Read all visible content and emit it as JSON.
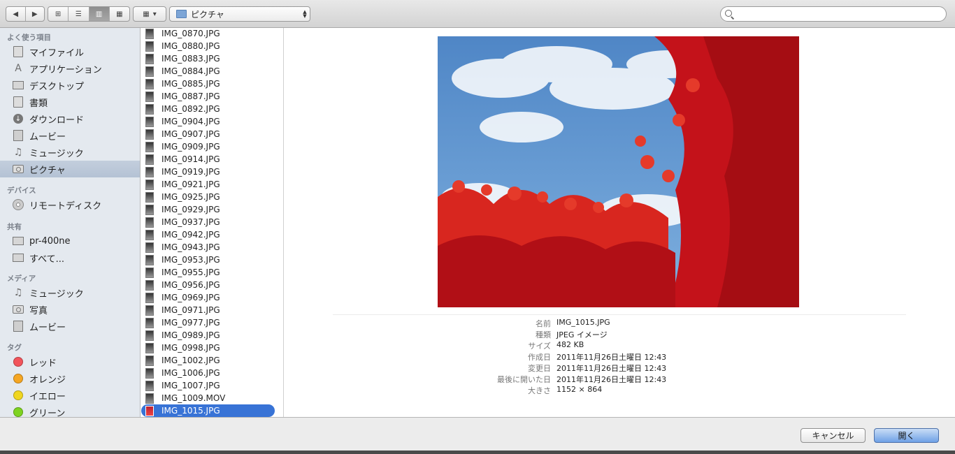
{
  "toolbar": {
    "back_icon": "◀",
    "forward_icon": "▶",
    "view_icons": [
      "⊞",
      "☰",
      "▥",
      "▦"
    ],
    "arrange_icon": "▦",
    "arrange_caret": "▾",
    "location": "ピクチャ",
    "location_arrows_up": "▲",
    "location_arrows_down": "▼",
    "search_placeholder": ""
  },
  "sidebar": {
    "sections": {
      "favorites": "よく使う項目",
      "devices": "デバイス",
      "shared": "共有",
      "media": "メディア",
      "tags": "タグ"
    },
    "favorites": [
      {
        "label": "マイファイル",
        "icon": "all-files-icon"
      },
      {
        "label": "アプリケーション",
        "icon": "applications-icon"
      },
      {
        "label": "デスクトップ",
        "icon": "desktop-icon"
      },
      {
        "label": "書類",
        "icon": "documents-icon"
      },
      {
        "label": "ダウンロード",
        "icon": "downloads-icon"
      },
      {
        "label": "ムービー",
        "icon": "movies-icon"
      },
      {
        "label": "ミュージック",
        "icon": "music-icon"
      },
      {
        "label": "ピクチャ",
        "icon": "pictures-icon",
        "selected": true
      }
    ],
    "devices": [
      {
        "label": "リモートディスク",
        "icon": "remote-disc-icon"
      }
    ],
    "shared": [
      {
        "label": "pr-400ne",
        "icon": "computer-icon"
      },
      {
        "label": "すべて...",
        "icon": "network-icon"
      }
    ],
    "media": [
      {
        "label": "ミュージック",
        "icon": "music-icon"
      },
      {
        "label": "写真",
        "icon": "camera-icon"
      },
      {
        "label": "ムービー",
        "icon": "movies-icon"
      }
    ],
    "tags": [
      {
        "label": "レッド",
        "color": "#f2545b"
      },
      {
        "label": "オレンジ",
        "color": "#f5a623"
      },
      {
        "label": "イエロー",
        "color": "#f0d620"
      },
      {
        "label": "グリーン",
        "color": "#7ed321"
      }
    ],
    "glyphs": {
      "apps": "A",
      "download": "↓",
      "music": "♫"
    }
  },
  "files": [
    "IMG_0870.JPG",
    "IMG_0880.JPG",
    "IMG_0883.JPG",
    "IMG_0884.JPG",
    "IMG_0885.JPG",
    "IMG_0887.JPG",
    "IMG_0892.JPG",
    "IMG_0904.JPG",
    "IMG_0907.JPG",
    "IMG_0909.JPG",
    "IMG_0914.JPG",
    "IMG_0919.JPG",
    "IMG_0921.JPG",
    "IMG_0925.JPG",
    "IMG_0929.JPG",
    "IMG_0937.JPG",
    "IMG_0942.JPG",
    "IMG_0943.JPG",
    "IMG_0953.JPG",
    "IMG_0955.JPG",
    "IMG_0956.JPG",
    "IMG_0969.JPG",
    "IMG_0971.JPG",
    "IMG_0977.JPG",
    "IMG_0989.JPG",
    "IMG_0998.JPG",
    "IMG_1002.JPG",
    "IMG_1006.JPG",
    "IMG_1007.JPG",
    "IMG_1009.MOV",
    "IMG_1015.JPG"
  ],
  "selected_file": "IMG_1015.JPG",
  "preview": {
    "info": [
      {
        "key": "名前",
        "value": "IMG_1015.JPG"
      },
      {
        "key": "種類",
        "value": "JPEG イメージ"
      },
      {
        "key": "サイズ",
        "value": "482 KB"
      },
      {
        "key": "作成日",
        "value": "2011年11月26日土曜日 12:43"
      },
      {
        "key": "変更日",
        "value": "2011年11月26日土曜日 12:43"
      },
      {
        "key": "最後に開いた日",
        "value": "2011年11月26日土曜日 12:43"
      },
      {
        "key": "大きさ",
        "value": "1152 × 864"
      }
    ]
  },
  "buttons": {
    "cancel": "キャンセル",
    "open": "開く"
  }
}
